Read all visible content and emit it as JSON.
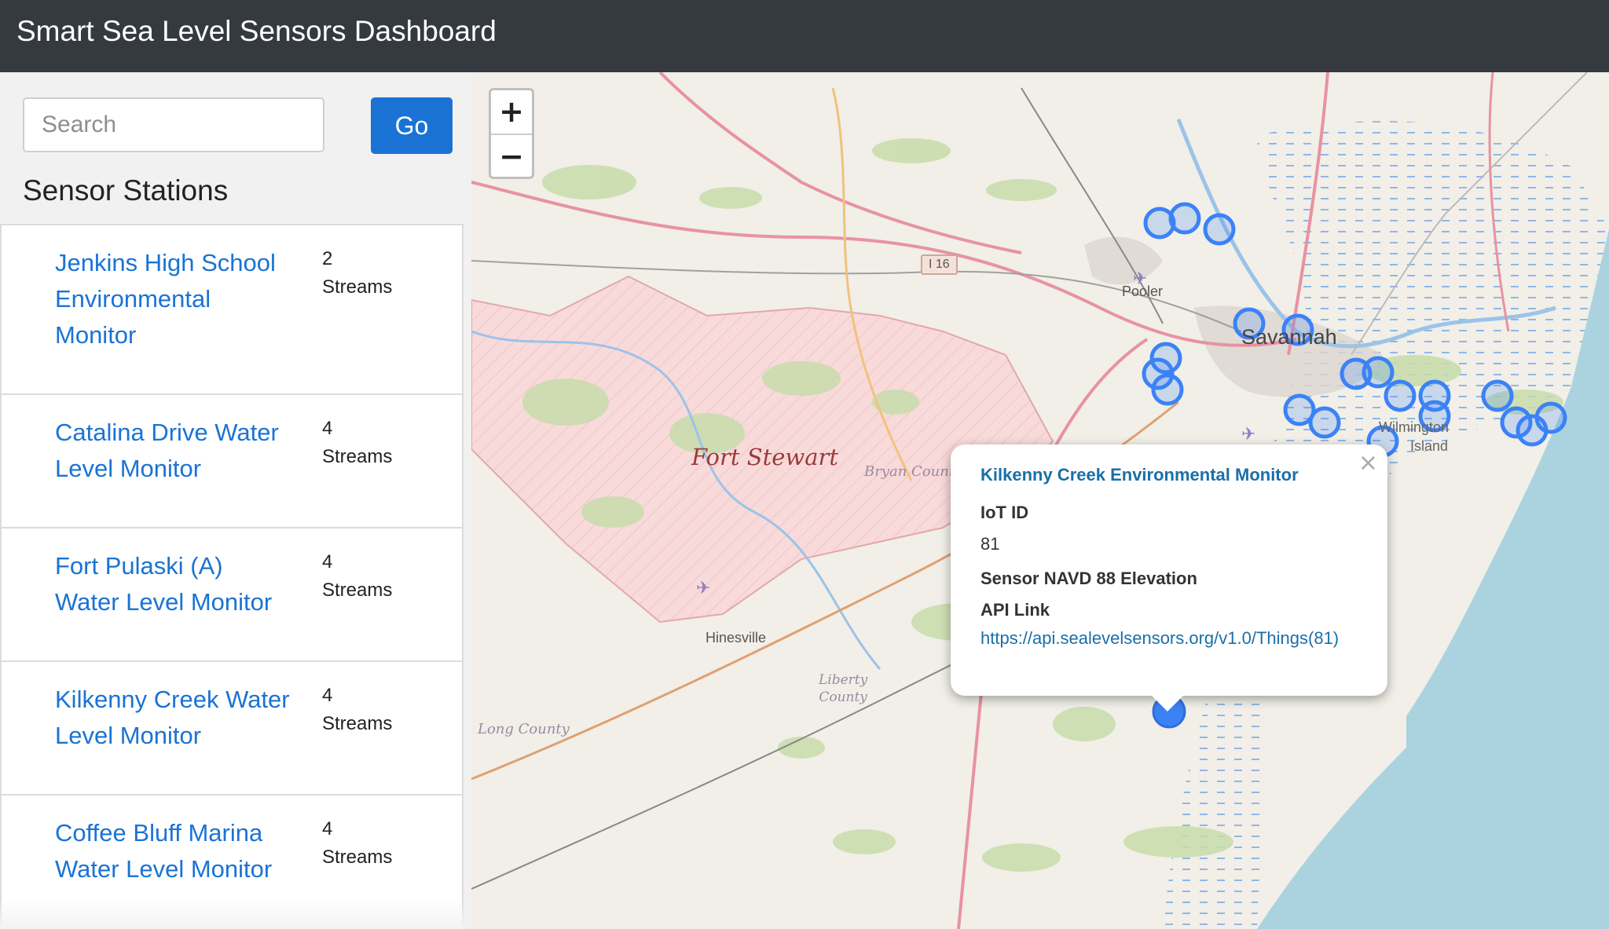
{
  "header": {
    "title": "Smart Sea Level Sensors Dashboard"
  },
  "search": {
    "placeholder": "Search",
    "value": "",
    "go_label": "Go"
  },
  "sidebar": {
    "heading": "Sensor Stations",
    "stations": [
      {
        "name": "Jenkins High School Environmental Monitor",
        "count": "2",
        "unit": "Streams"
      },
      {
        "name": "Catalina Drive Water Level Monitor",
        "count": "4",
        "unit": "Streams"
      },
      {
        "name": "Fort Pulaski (A) Water Level Monitor",
        "count": "4",
        "unit": "Streams"
      },
      {
        "name": "Kilkenny Creek Water Level Monitor",
        "count": "4",
        "unit": "Streams"
      },
      {
        "name": "Coffee Bluff Marina Water Level Monitor",
        "count": "4",
        "unit": "Streams"
      }
    ]
  },
  "map": {
    "zoom_in": "+",
    "zoom_out": "−",
    "labels": {
      "fort_stewart": "Fort Stewart",
      "bryan_county": "Bryan County",
      "hinesville": "Hinesville",
      "liberty_county_1": "Liberty",
      "liberty_county_2": "County",
      "long_county": "Long County",
      "pooler": "Pooler",
      "savannah": "Savannah",
      "wilmington_1": "Wilmington",
      "wilmington_2": "Island",
      "highway": "I 16"
    },
    "marker_color": "#3b82f6"
  },
  "popup": {
    "close": "×",
    "title": "Kilkenny Creek Environmental Monitor",
    "iot_label": "IoT ID",
    "iot_value": "81",
    "elevation_label": "Sensor NAVD 88 Elevation",
    "api_label": "API Link",
    "api_url": "https://api.sealevelsensors.org/v1.0/Things(81)"
  }
}
